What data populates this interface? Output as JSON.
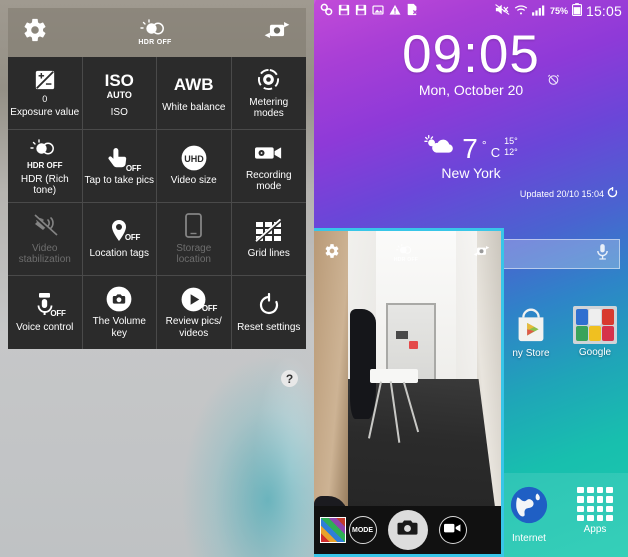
{
  "left_screen": {
    "name": "camera-settings-screen",
    "topbar": {
      "settings_icon": "gear-icon",
      "hdr_label": "HDR OFF",
      "hdr_icon": "hdr-icon",
      "switch_camera_icon": "switch-camera-icon"
    },
    "settings_grid": [
      {
        "icon": "exposure-icon",
        "value": "0",
        "label": "Exposure value",
        "sub": "",
        "badge": "",
        "disabled": false
      },
      {
        "icon": "iso-icon",
        "value": "ISO",
        "label": "ISO",
        "sub": "AUTO",
        "badge": "",
        "disabled": false
      },
      {
        "icon": "awb-icon",
        "value": "AWB",
        "label": "White balance",
        "sub": "",
        "badge": "",
        "disabled": false
      },
      {
        "icon": "metering-icon",
        "value": "",
        "label": "Metering modes",
        "sub": "",
        "badge": "",
        "disabled": false
      },
      {
        "icon": "hdr-icon",
        "value": "HDR OFF",
        "label": "HDR (Rich tone)",
        "sub": "",
        "badge": "",
        "disabled": false
      },
      {
        "icon": "tap-to-take-icon",
        "value": "",
        "label": "Tap to take pics",
        "sub": "",
        "badge": "OFF",
        "disabled": false
      },
      {
        "icon": "uhd-icon",
        "value": "UHD",
        "label": "Video size",
        "sub": "",
        "badge": "",
        "disabled": false
      },
      {
        "icon": "camcorder-icon",
        "value": "",
        "label": "Recording mode",
        "sub": "",
        "badge": "",
        "disabled": false
      },
      {
        "icon": "video-stabilization-icon",
        "value": "",
        "label": "Video stabilization",
        "sub": "",
        "badge": "",
        "disabled": true
      },
      {
        "icon": "location-pin-icon",
        "value": "",
        "label": "Location tags",
        "sub": "",
        "badge": "OFF",
        "disabled": false
      },
      {
        "icon": "storage-phone-icon",
        "value": "",
        "label": "Storage location",
        "sub": "",
        "badge": "",
        "disabled": true
      },
      {
        "icon": "grid-lines-icon",
        "value": "",
        "label": "Grid lines",
        "sub": "",
        "badge": "",
        "disabled": false
      },
      {
        "icon": "voice-control-icon",
        "value": "",
        "label": "Voice control",
        "sub": "",
        "badge": "OFF",
        "disabled": false
      },
      {
        "icon": "volume-key-camera-icon",
        "value": "",
        "label": "The Volume key",
        "sub": "",
        "badge": "",
        "disabled": false
      },
      {
        "icon": "review-pics-icon",
        "value": "",
        "label": "Review pics/ videos",
        "sub": "",
        "badge": "OFF",
        "disabled": false
      },
      {
        "icon": "reset-icon",
        "value": "",
        "label": "Reset settings",
        "sub": "",
        "badge": "",
        "disabled": false
      }
    ],
    "help_button": {
      "label": "?",
      "icon": "help-icon"
    }
  },
  "right_screen": {
    "name": "home-screen-with-camera",
    "statusbar": {
      "left_icons": [
        "link-icon",
        "sd-save-icon",
        "sd-save-icon-2",
        "image-saved-icon",
        "warning-icon",
        "sim-removed-icon"
      ],
      "right_icons": [
        "mute-icon",
        "wifi-icon",
        "signal-icon"
      ],
      "battery_percent": "75%",
      "battery_icon": "battery-icon",
      "clock": "15:05"
    },
    "clock_widget": {
      "time": "09:05",
      "date": "Mon, October 20",
      "alarm_icon": "alarm-off-icon"
    },
    "weather_widget": {
      "icon": "partly-cloudy-icon",
      "temp": "7",
      "deg": "°",
      "unit": "C",
      "high": "15°",
      "low": "12°",
      "city": "New York",
      "updated": "Updated 20/10 15:04",
      "refresh_icon": "refresh-icon"
    },
    "search_bar": {
      "mic_icon": "microphone-icon",
      "placeholder": ""
    },
    "shortcuts": [
      {
        "label": "ny Store",
        "icon": "play-store-icon"
      },
      {
        "label": "Google",
        "icon": "google-folder-icon"
      }
    ],
    "folder_app_colors": [
      "#2f6fd0",
      "#e8e8e8",
      "#d83a2f",
      "#3aa35a",
      "#f0c020",
      "#d6324a"
    ],
    "dock": [
      {
        "label": "Internet",
        "icon": "internet-globe-icon"
      },
      {
        "label": "Apps",
        "icon": "apps-grid-icon"
      }
    ],
    "camera_overlay": {
      "border_color": "#38c6e8",
      "settings_icon": "gear-icon",
      "hdr_label": "HDR OFF",
      "switch_camera_icon": "switch-camera-icon",
      "mode_label": "MODE",
      "gallery_thumb_icon": "gallery-thumbnail",
      "shutter_icon": "camera-shutter-icon",
      "record_icon": "camcorder-icon"
    }
  }
}
